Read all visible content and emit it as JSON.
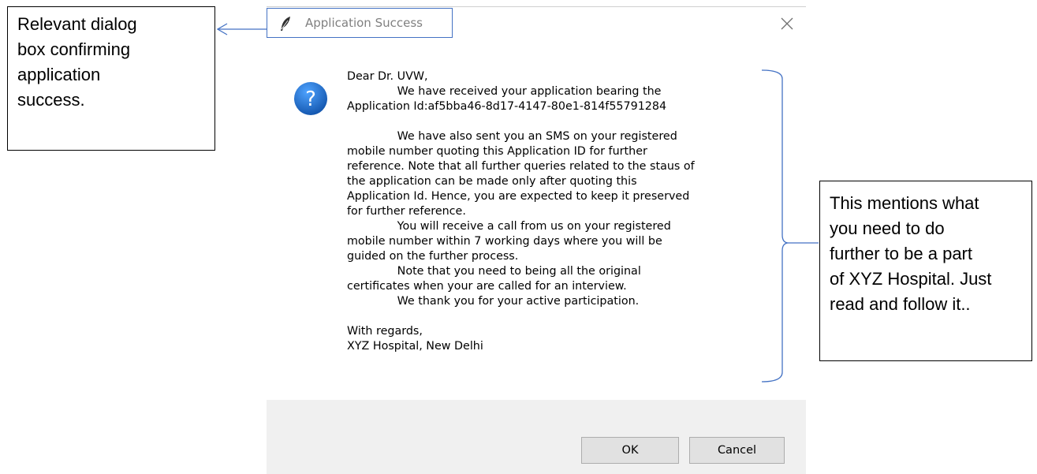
{
  "annotations": {
    "left": "Relevant dialog\nbox confirming\napplication\nsuccess.",
    "right": "This mentions what\nyou need to do\nfurther to be a part\nof XYZ Hospital. Just\nread and follow it.."
  },
  "dialog": {
    "title": "Application Success",
    "icons": {
      "app": "feather-icon",
      "close": "close-icon",
      "message": "question-icon"
    },
    "message_lines": [
      "Dear Dr. UVW,",
      "              We have received your application bearing the",
      "Application Id:af5bba46-8d17-4147-80e1-814f55791284",
      "",
      "              We have also sent you an SMS on your registered",
      "mobile number quoting this Application ID for further",
      "reference. Note that all further queries related to the staus of",
      "the application can be made only after quoting this",
      "Application Id. Hence, you are expected to keep it preserved",
      "for further reference.",
      "              You will receive a call from us on your registered",
      "mobile number within 7 working days where you will be",
      "guided on the further process.",
      "              Note that you need to being all the original",
      "certificates when your are called for an interview.",
      "              We thank you for your active participation.",
      "",
      "With regards,",
      "XYZ Hospital, New Delhi"
    ],
    "buttons": {
      "ok": "OK",
      "cancel": "Cancel"
    }
  },
  "colors": {
    "connector": "#4472c4",
    "question_icon": "#1e6fcc",
    "footer": "#f0f0f0",
    "button": "#e1e1e1"
  }
}
